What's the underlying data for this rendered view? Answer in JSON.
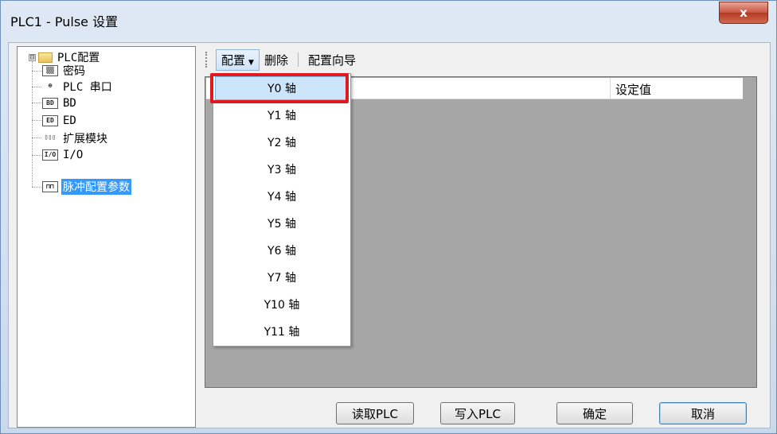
{
  "window": {
    "title": "PLC1 - Pulse  设置",
    "close_label": "x"
  },
  "tree": {
    "root": {
      "expander": "⊟",
      "label": "PLC配置"
    },
    "items": [
      {
        "icon": "▒▒",
        "label": "密码"
      },
      {
        "icon": "⊕",
        "label": "PLC 串口"
      },
      {
        "icon": "BD",
        "label": "BD"
      },
      {
        "icon": "ED",
        "label": "ED"
      },
      {
        "icon": "▯▯▯",
        "label": "扩展模块"
      },
      {
        "icon": "I/O",
        "label": "I/O"
      },
      {
        "icon": "⊓⊓",
        "label": "脉冲配置参数"
      }
    ]
  },
  "toolbar": {
    "config_label": "配置",
    "delete_label": "删除",
    "wizard_label": "配置向导"
  },
  "grid": {
    "column_header": "设定值"
  },
  "dropdown": {
    "items": [
      "Y0 轴",
      "Y1 轴",
      "Y2 轴",
      "Y3 轴",
      "Y4 轴",
      "Y5 轴",
      "Y6 轴",
      "Y7 轴",
      "Y10 轴",
      "Y11 轴"
    ]
  },
  "buttons": {
    "read_plc": "读取PLC",
    "write_plc": "写入PLC",
    "ok": "确定",
    "cancel": "取消"
  }
}
